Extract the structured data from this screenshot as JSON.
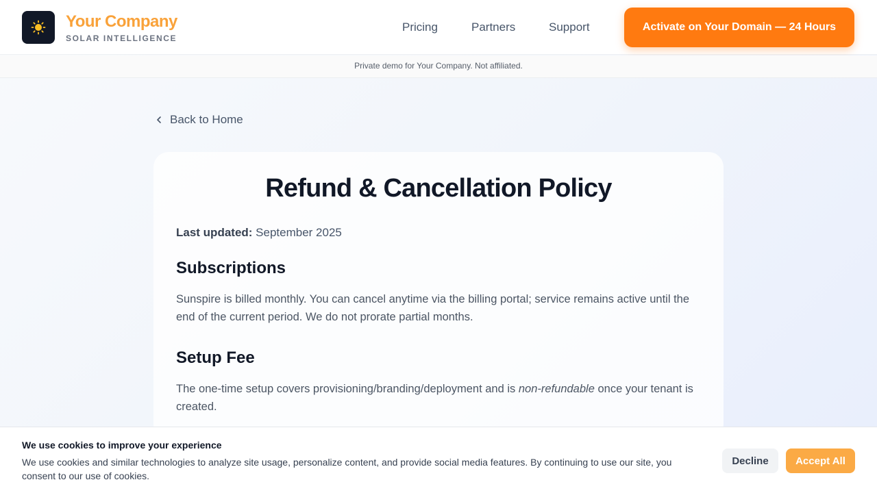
{
  "header": {
    "brand_name": "Your Company",
    "brand_tagline": "SOLAR INTELLIGENCE",
    "logo_icon": "sun-icon",
    "nav": [
      {
        "label": "Pricing"
      },
      {
        "label": "Partners"
      },
      {
        "label": "Support"
      }
    ],
    "cta_label": "Activate on Your Domain — 24 Hours"
  },
  "notice": "Private demo for Your Company. Not affiliated.",
  "back_link": {
    "label": "Back to Home",
    "icon": "chevron-left-icon"
  },
  "policy": {
    "title": "Refund & Cancellation Policy",
    "updated_label": "Last updated:",
    "updated_value": " September 2025",
    "sections": [
      {
        "heading": "Subscriptions",
        "text": "Sunspire is billed monthly. You can cancel anytime via the billing portal; service remains active until the end of the current period. We do not prorate partial months."
      },
      {
        "heading": "Setup Fee",
        "text_before": "The one-time setup covers provisioning/branding/deployment and is ",
        "text_emphasis": "non-refundable",
        "text_after": " once your tenant is created."
      }
    ]
  },
  "cookie": {
    "title": "We use cookies to improve your experience",
    "text": "We use cookies and similar technologies to analyze site usage, personalize content, and provide social media features. By continuing to use our site, you consent to our use of cookies.",
    "decline_label": "Decline",
    "accept_label": "Accept All"
  },
  "colors": {
    "brand": "#f9a23a",
    "cta": "#ff7a10",
    "accept": "#fbaa45",
    "heading": "#111827"
  }
}
